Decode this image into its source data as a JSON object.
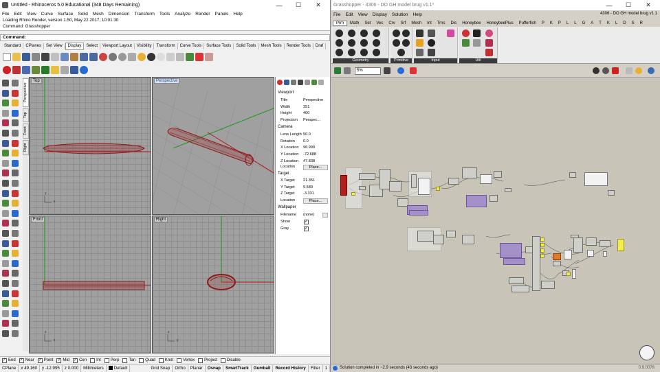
{
  "rhino": {
    "title": "Untitled - Rhinoceros 5.0 Educational (348 Days Remaining)",
    "menu": [
      "File",
      "Edit",
      "View",
      "Curve",
      "Surface",
      "Solid",
      "Mesh",
      "Dimension",
      "Transform",
      "Tools",
      "Analyze",
      "Render",
      "Panels",
      "Help"
    ],
    "history": [
      "Loading Rhino Render, version 1.50, May 22 2017, 10:01:30",
      "Command: Grasshopper"
    ],
    "command_label": "Command:",
    "toolbar_tabs": [
      "Standard",
      "CPlanes",
      "Set View",
      "Display",
      "Select",
      "Viewport Layout",
      "Visibility",
      "Transform",
      "Curve Tools",
      "Surface Tools",
      "Solid Tools",
      "Mesh Tools",
      "Render Tools",
      "Draf"
    ],
    "active_tab_index": 3,
    "viewport_side_tabs": [
      "Perspective",
      "Top",
      "Front",
      "Right"
    ],
    "viewports": {
      "top": "Top",
      "perspective": "Perspective",
      "front": "Front",
      "right": "Right"
    },
    "properties": {
      "viewport_header": "Viewport",
      "rows1": [
        {
          "k": "Title",
          "v": "Perspective"
        },
        {
          "k": "Width",
          "v": "351"
        },
        {
          "k": "Height",
          "v": "400"
        },
        {
          "k": "Projection",
          "v": "Perspec..."
        }
      ],
      "camera_header": "Camera",
      "rows2": [
        {
          "k": "Lens Length",
          "v": "50.0"
        },
        {
          "k": "Rotation",
          "v": "0.0"
        },
        {
          "k": "X Location",
          "v": "96.999"
        },
        {
          "k": "Y Location",
          "v": "-72.688"
        },
        {
          "k": "Z Location",
          "v": "47.838"
        }
      ],
      "location_label": "Location",
      "place_btn": "Place...",
      "target_header": "Target",
      "rows3": [
        {
          "k": "X Target",
          "v": "21.351"
        },
        {
          "k": "Y Target",
          "v": "9.580"
        },
        {
          "k": "Z Target",
          "v": "-3.331"
        }
      ],
      "wallpaper_header": "Wallpaper",
      "filename_label": "Filename",
      "filename_value": "(none)",
      "show_label": "Show",
      "gray_label": "Gray"
    },
    "osnaps": [
      {
        "label": "End",
        "on": true
      },
      {
        "label": "Near",
        "on": true
      },
      {
        "label": "Point",
        "on": true
      },
      {
        "label": "Mid",
        "on": true
      },
      {
        "label": "Cen",
        "on": true
      },
      {
        "label": "Int",
        "on": false
      },
      {
        "label": "Perp",
        "on": false
      },
      {
        "label": "Tan",
        "on": false
      },
      {
        "label": "Quad",
        "on": false
      },
      {
        "label": "Knot",
        "on": false
      },
      {
        "label": "Vertex",
        "on": false
      },
      {
        "label": "Project",
        "on": false
      },
      {
        "label": "Disable",
        "on": false
      }
    ],
    "status": {
      "cplane": "CPlane",
      "x": "x 49.160",
      "y": "y -12.995",
      "z": "z 0.000",
      "units": "Millimeters",
      "layer": "Default",
      "toggles": [
        "Grid Snap",
        "Ortho",
        "Planar",
        "Osnap",
        "SmartTrack",
        "Gumball",
        "Record History",
        "Filter"
      ],
      "bold_toggles": [
        "Osnap",
        "SmartTrack",
        "Gumball",
        "Record History"
      ],
      "trail": "1"
    }
  },
  "gh": {
    "title": "Grasshopper - 4306 - DO GH model brug v1.1*",
    "menu": [
      "File",
      "Edit",
      "View",
      "Display",
      "Solution",
      "Help"
    ],
    "doc_name": "4306 - DO GH model brug v1.1",
    "tabs": [
      "Prm",
      "Math",
      "Set",
      "Vec",
      "Crv",
      "Srf",
      "Mesh",
      "Int",
      "Trns",
      "Dis",
      "Honeybee",
      "HoneybeePlus",
      "Pufferfish",
      "P",
      "K",
      "P",
      "L",
      "L",
      "G",
      "A",
      "T",
      "K",
      "L",
      "D",
      "S",
      "R"
    ],
    "groups": [
      "Geometry",
      "Primitive",
      "Input",
      "Util"
    ],
    "zoom": "5%",
    "solution_status": "Solution completed in ~2.9 seconds (43 seconds ago)",
    "version": "0.9.0076"
  },
  "colors": {
    "accent": "#2c4d8a",
    "geometry": "#8b1a1a",
    "canvas": "#c8c4b8"
  }
}
